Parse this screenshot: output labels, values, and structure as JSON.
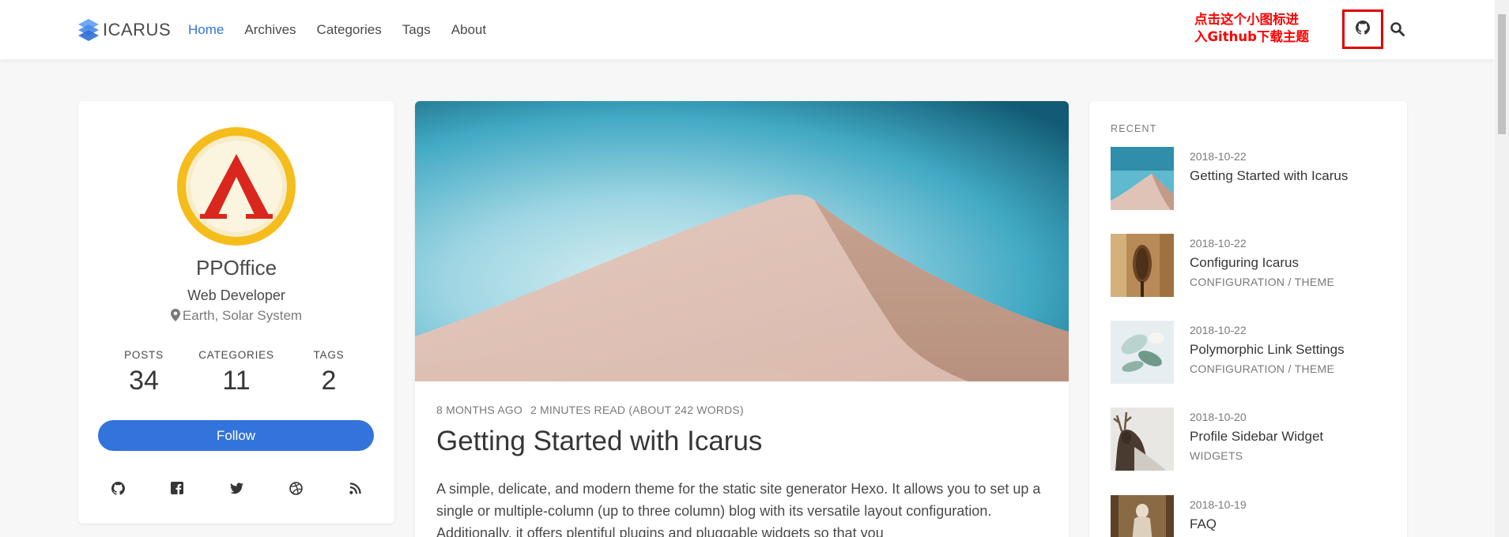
{
  "navbar": {
    "brand": "ICARUS",
    "links": [
      "Home",
      "Archives",
      "Categories",
      "Tags",
      "About"
    ],
    "active_link": "Home",
    "annotation": "点击这个小图标进\n入Github下载主题",
    "accent_color": "#3273dc",
    "annotation_color": "#ff0000"
  },
  "profile": {
    "name": "PPOffice",
    "role": "Web Developer",
    "location": "Earth, Solar System",
    "stats": [
      {
        "label": "POSTS",
        "value": "34"
      },
      {
        "label": "CATEGORIES",
        "value": "11"
      },
      {
        "label": "TAGS",
        "value": "2"
      }
    ],
    "follow_label": "Follow",
    "socials": [
      "github-icon",
      "facebook-icon",
      "twitter-icon",
      "dribbble-icon",
      "rss-icon"
    ]
  },
  "post": {
    "meta_time": "8 MONTHS AGO",
    "meta_read": "2 MINUTES READ (ABOUT 242 WORDS)",
    "title": "Getting Started with Icarus",
    "excerpt": "A simple, delicate, and modern theme for the static site generator Hexo. It allows you to set up a single or multiple-column (up to three column) blog with its versatile layout configuration. Additionally, it offers plentiful plugins and pluggable widgets so that you"
  },
  "recent": {
    "heading": "RECENT",
    "items": [
      {
        "date": "2018-10-22",
        "title": "Getting Started with Icarus",
        "cat1": "",
        "cat2": ""
      },
      {
        "date": "2018-10-22",
        "title": "Configuring Icarus",
        "cat1": "CONFIGURATION",
        "cat2": "THEME"
      },
      {
        "date": "2018-10-22",
        "title": "Polymorphic Link Settings",
        "cat1": "CONFIGURATION",
        "cat2": "THEME"
      },
      {
        "date": "2018-10-20",
        "title": "Profile Sidebar Widget",
        "cat1": "WIDGETS",
        "cat2": ""
      },
      {
        "date": "2018-10-19",
        "title": "FAQ",
        "cat1": "",
        "cat2": ""
      }
    ],
    "separator": "/"
  }
}
